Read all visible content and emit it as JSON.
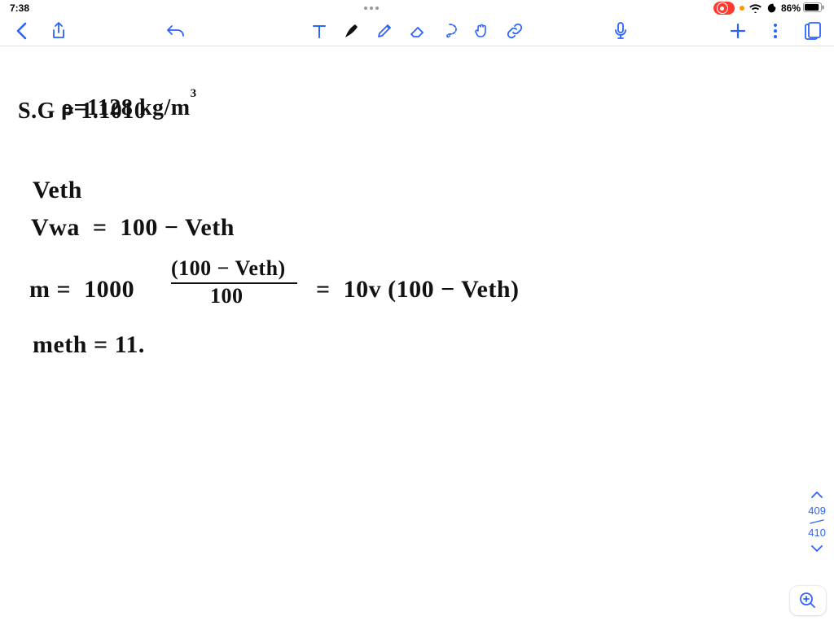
{
  "status": {
    "time": "7:38",
    "battery_pct": "86%",
    "battery_level": 0.86
  },
  "toolbar": {
    "icons": {
      "back": "chevron-left",
      "share": "share",
      "undo": "undo",
      "text": "text-tool",
      "pen": "pen-tool",
      "pencil": "pencil-tool",
      "eraser": "eraser-tool",
      "lasso": "lasso-tool",
      "hand": "hand-tool",
      "link": "link-tool",
      "mic": "microphone",
      "add": "plus",
      "more": "more-vertical",
      "pages": "pages-panel"
    }
  },
  "pages": {
    "current": "409",
    "total": "410"
  },
  "notes": {
    "line1": "ρ=1128 kg/m",
    "line1_sup": "3",
    "line2": "S.G = 1.1010",
    "line3": "Veth",
    "line4": "Vwa  =  100 − Veth",
    "line5a": "m =  1000 ",
    "line5_num": "(100 − Veth)",
    "line5_den": "100",
    "line5b": " =  10v (100 − Veth)",
    "line6": "meth = 11."
  }
}
